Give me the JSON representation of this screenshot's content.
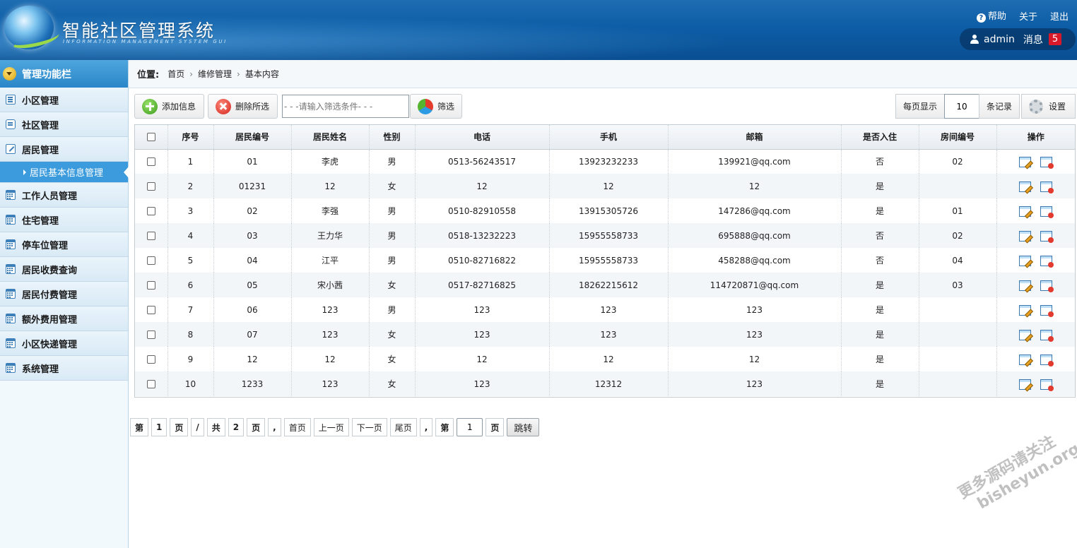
{
  "header": {
    "title": "智能社区管理系统",
    "subtitle": "INFORMATION MANAGEMENT SYSTEM GUI",
    "links": {
      "help": "帮助",
      "about": "关于",
      "logout": "退出"
    },
    "user": "admin",
    "message_label": "消息",
    "message_count": "5"
  },
  "sidebar": {
    "title": "管理功能栏",
    "items": [
      {
        "label": "小区管理",
        "icon": "list-icon"
      },
      {
        "label": "社区管理",
        "icon": "chat-icon"
      },
      {
        "label": "居民管理",
        "icon": "edit-icon"
      },
      {
        "label": "工作人员管理",
        "icon": "calendar-icon"
      },
      {
        "label": "住宅管理",
        "icon": "calendar-icon"
      },
      {
        "label": "停车位管理",
        "icon": "calendar-icon"
      },
      {
        "label": "居民收费查询",
        "icon": "calendar-icon"
      },
      {
        "label": "居民付费管理",
        "icon": "calendar-icon"
      },
      {
        "label": "额外费用管理",
        "icon": "calendar-icon"
      },
      {
        "label": "小区快递管理",
        "icon": "calendar-icon"
      },
      {
        "label": "系统管理",
        "icon": "calendar-icon"
      }
    ],
    "active_sub": "居民基本信息管理"
  },
  "breadcrumb": {
    "label": "位置:",
    "items": [
      "首页",
      "维修管理",
      "基本内容"
    ]
  },
  "toolbar": {
    "add_label": "添加信息",
    "delete_label": "删除所选",
    "filter_placeholder": "- - -请输入筛选条件- - -",
    "filter_label": "筛选",
    "per_page_label": "每页显示",
    "per_page_value": "10",
    "records_label": "条记录",
    "settings_label": "设置"
  },
  "table": {
    "columns": [
      "序号",
      "居民编号",
      "居民姓名",
      "性别",
      "电话",
      "手机",
      "邮箱",
      "是否入住",
      "房间编号",
      "操作"
    ],
    "rows": [
      [
        "1",
        "01",
        "李虎",
        "男",
        "0513-56243517",
        "13923232233",
        "139921@qq.com",
        "否",
        "02"
      ],
      [
        "2",
        "01231",
        "12",
        "女",
        "12",
        "12",
        "12",
        "是",
        ""
      ],
      [
        "3",
        "02",
        "李强",
        "男",
        "0510-82910558",
        "13915305726",
        "147286@qq.com",
        "是",
        "01"
      ],
      [
        "4",
        "03",
        "王力华",
        "男",
        "0518-13232223",
        "15955558733",
        "695888@qq.com",
        "否",
        "02"
      ],
      [
        "5",
        "04",
        "江平",
        "男",
        "0510-82716822",
        "15955558733",
        "458288@qq.com",
        "否",
        "04"
      ],
      [
        "6",
        "05",
        "宋小茜",
        "女",
        "0517-82716825",
        "18262215612",
        "114720871@qq.com",
        "是",
        "03"
      ],
      [
        "7",
        "06",
        "123",
        "男",
        "123",
        "123",
        "123",
        "是",
        ""
      ],
      [
        "8",
        "07",
        "123",
        "女",
        "123",
        "123",
        "123",
        "是",
        ""
      ],
      [
        "9",
        "12",
        "12",
        "女",
        "12",
        "12",
        "12",
        "是",
        ""
      ],
      [
        "10",
        "1233",
        "123",
        "女",
        "123",
        "12312",
        "123",
        "是",
        ""
      ]
    ]
  },
  "pager": {
    "di": "第",
    "current": "1",
    "ye": "页",
    "slash": "/",
    "gong": "共",
    "total": "2",
    "ye2": "页",
    "comma": ",",
    "first": "首页",
    "prev": "上一页",
    "next": "下一页",
    "last": "尾页",
    "comma2": ",",
    "di2": "第",
    "jump_value": "1",
    "ye3": "页",
    "jump": "跳转"
  },
  "watermark": {
    "line1": "更多源码请关注",
    "line2": "bisheyun.org"
  }
}
